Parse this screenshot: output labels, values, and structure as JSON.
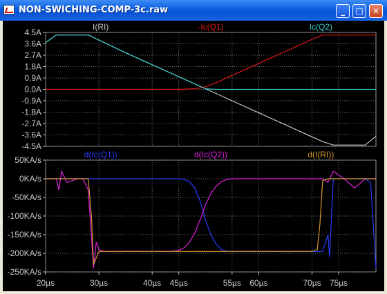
{
  "window": {
    "title": "NON-SWICHING-COMP-3c.raw",
    "minimize_glyph": "_",
    "maximize_glyph": "□",
    "close_glyph": "✕",
    "colors": {
      "titlebar": "#0a5fe0",
      "plot_bg": "#000000",
      "grid": "#6e6e6e",
      "axis_text": "#c8c8c8"
    }
  },
  "chart_data": [
    {
      "type": "line",
      "panel": "top",
      "x": [
        20,
        22,
        26,
        28,
        35,
        40,
        45,
        48,
        50,
        52,
        55,
        60,
        65,
        70,
        72,
        74,
        78,
        80,
        82
      ],
      "ylim": [
        -4.5,
        4.5
      ],
      "yticks": [
        "4.5A",
        "3.6A",
        "2.7A",
        "1.8A",
        "0.9A",
        "0.0A",
        "-0.9A",
        "-1.8A",
        "-2.7A",
        "-3.6A",
        "-4.5A"
      ],
      "grid": true,
      "series": [
        {
          "name": "I(RI)",
          "color": "#c8c8c8",
          "values": [
            3.7,
            4.3,
            4.3,
            4.3,
            2.9,
            1.95,
            1.0,
            0.43,
            0.05,
            -0.33,
            -0.9,
            -1.85,
            -2.8,
            -3.75,
            -4.13,
            -4.4,
            -4.4,
            -4.4,
            -3.7
          ]
        },
        {
          "name": "-Ic(Q1)",
          "color": "#e01818",
          "values": [
            0.0,
            0.0,
            0.0,
            0.0,
            0.0,
            0.0,
            0.0,
            0.05,
            0.2,
            0.53,
            1.1,
            2.05,
            3.0,
            3.95,
            4.3,
            4.3,
            4.3,
            4.3,
            4.3
          ]
        },
        {
          "name": "Ic(Q2)",
          "color": "#35c8c8",
          "values": [
            3.7,
            4.3,
            4.3,
            4.3,
            2.9,
            1.95,
            1.0,
            0.43,
            0.05,
            0.0,
            0.0,
            0.0,
            0.0,
            0.0,
            0.0,
            0.0,
            0.0,
            0.0,
            0.0
          ]
        }
      ]
    },
    {
      "type": "line",
      "panel": "bottom",
      "ylim": [
        -250,
        50
      ],
      "yticks": [
        "50KA/s",
        "0KA/s",
        "-50KA/s",
        "-100KA/s",
        "-150KA/s",
        "-200KA/s",
        "-250KA/s"
      ],
      "xticks": [
        "20µs",
        "30µs",
        "40µs",
        "45µs",
        "55µs",
        "60µs",
        "70µs",
        "75µs"
      ],
      "xtick_values": [
        20,
        30,
        40,
        45,
        55,
        60,
        70,
        75
      ],
      "xlim": [
        20,
        82
      ],
      "grid": true,
      "series": [
        {
          "name": "d(Ic(Q1))",
          "color": "#2b3cff",
          "x": [
            20,
            28,
            28.5,
            45,
            46,
            47,
            48,
            49,
            50,
            51,
            52,
            53,
            54,
            55,
            56,
            60,
            70,
            72,
            73,
            73.3,
            74,
            76,
            78,
            80,
            81,
            82
          ],
          "values": [
            0,
            0,
            0,
            0,
            -2,
            -8,
            -25,
            -60,
            -110,
            -150,
            -175,
            -190,
            -195,
            -195,
            -195,
            -195,
            -195,
            -195,
            -150,
            -210,
            0,
            0,
            0,
            0,
            -10,
            -240
          ]
        },
        {
          "name": "d(Ic(Q2))",
          "color": "#e020e0",
          "x": [
            20,
            22,
            22.5,
            23,
            24,
            25,
            26,
            27,
            28,
            29,
            29.5,
            30,
            31,
            43,
            44,
            45,
            46,
            47,
            48,
            49,
            50,
            51,
            52,
            53,
            54,
            55,
            56,
            60,
            70,
            72,
            73,
            74,
            76,
            78,
            80,
            82
          ],
          "values": [
            0,
            0,
            -30,
            20,
            -10,
            -5,
            0,
            0,
            -30,
            -240,
            -170,
            -190,
            -195,
            -195,
            -194,
            -192,
            -185,
            -170,
            -145,
            -110,
            -70,
            -40,
            -20,
            -8,
            -2,
            0,
            0,
            0,
            0,
            0,
            -10,
            20,
            0,
            -25,
            0,
            0
          ]
        },
        {
          "name": "d(I(RI))",
          "color": "#d89a30",
          "x": [
            20,
            22,
            24,
            26,
            28,
            28.6,
            29,
            30,
            31,
            40,
            50,
            60,
            70,
            71,
            71.5,
            72,
            73,
            74,
            76,
            78,
            80,
            82
          ],
          "values": [
            0,
            0,
            0,
            0,
            0,
            -100,
            -230,
            -195,
            -195,
            -195,
            -195,
            -195,
            -195,
            -190,
            -120,
            -5,
            0,
            0,
            0,
            0,
            0,
            0
          ]
        }
      ]
    }
  ]
}
